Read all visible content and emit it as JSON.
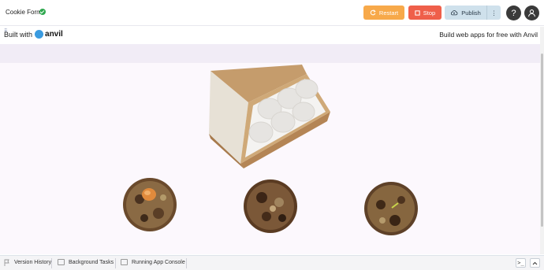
{
  "topbar": {
    "app_title": "Cookie Form",
    "restart_label": "Restart",
    "stop_label": "Stop",
    "publish_label": "Publish",
    "more_label": "⋮",
    "help_label": "?",
    "icons": {
      "status": "check-circle-icon",
      "restart": "refresh-icon",
      "stop": "stop-square-icon",
      "publish": "cloud-upload-icon",
      "account": "user-icon"
    },
    "colors": {
      "restart": "#f7a94a",
      "stop": "#ef5f4a",
      "publish": "#cfe1ec",
      "status": "#2fa84f"
    }
  },
  "app": {
    "built_with": "Built with",
    "anvil_brand": "anvil",
    "tagline": "Build web apps for free with Anvil",
    "images": [
      "cookie-box-image",
      "cookie-image-1",
      "cookie-image-2",
      "cookie-image-3"
    ]
  },
  "bottombar": {
    "tabs": [
      {
        "label": "Version History",
        "icon": "flag-icon"
      },
      {
        "label": "Background Tasks",
        "icon": "tasks-icon"
      },
      {
        "label": "Running App Console",
        "icon": "console-icon"
      }
    ],
    "terminal_icon": "terminal-icon",
    "collapse_icon": "chevron-up-icon"
  }
}
